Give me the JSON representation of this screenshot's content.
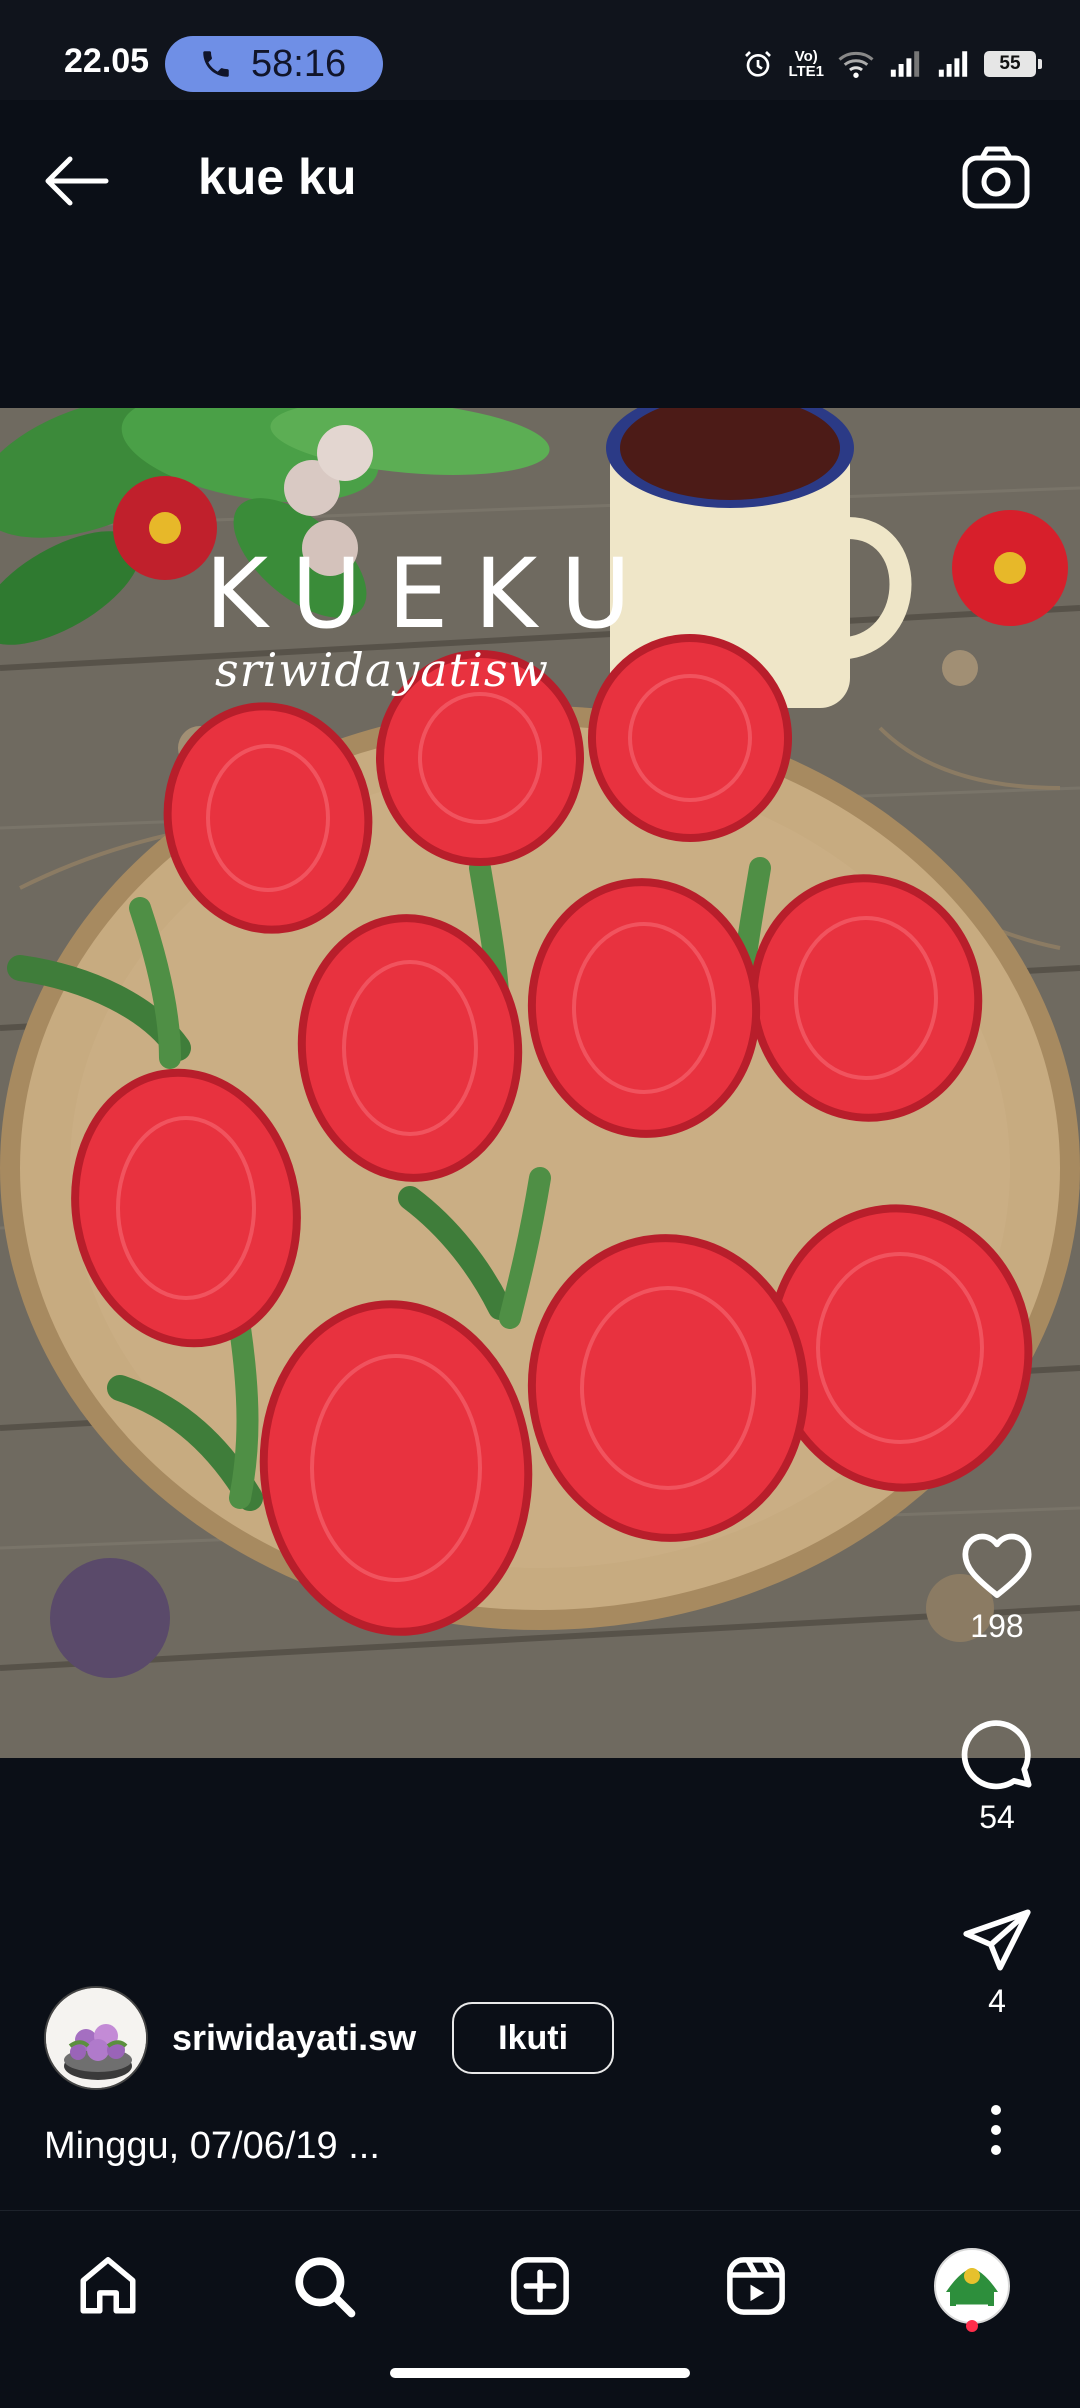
{
  "status_bar": {
    "time": "22.05",
    "call_duration": "58:16",
    "network_label_top": "Vo)",
    "network_label_bottom": "LTE1",
    "battery": "55"
  },
  "header": {
    "title": "kue ku"
  },
  "post": {
    "photo_title": "KUEKU",
    "photo_watermark": "sriwidayatisw",
    "likes": "198",
    "comments": "54",
    "shares": "4",
    "author": "sriwidayati.sw",
    "follow_label": "Ikuti",
    "caption": "Minggu, 07/06/19 ..."
  },
  "colors": {
    "background": "#0b0f17",
    "call_pill": "#6f8fe6",
    "notification_dot": "#ff2d4a",
    "cake_red": "#e8323f"
  },
  "icons": {
    "nav": [
      "home-icon",
      "search-icon",
      "add-icon",
      "reels-icon",
      "profile-avatar"
    ],
    "actions": [
      "heart-icon",
      "comment-icon",
      "share-icon",
      "more-icon"
    ]
  }
}
